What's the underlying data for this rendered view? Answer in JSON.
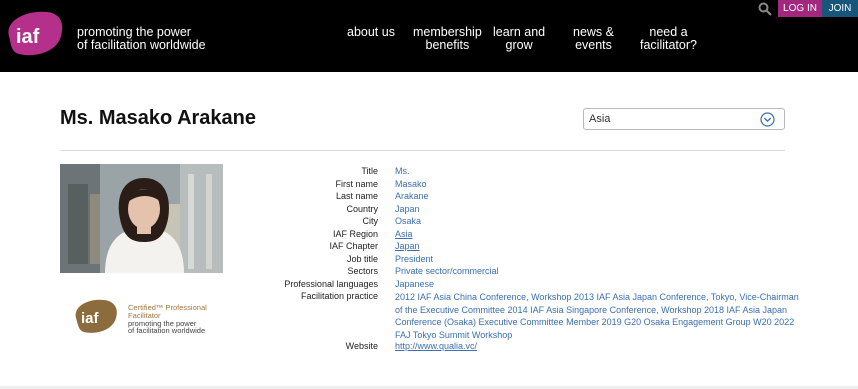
{
  "header": {
    "logo_text": "iaf",
    "tagline_line1": "promoting the power",
    "tagline_line2": "of facilitation worldwide",
    "nav": [
      {
        "line1": "about us",
        "line2": ""
      },
      {
        "line1": "membership",
        "line2": "benefits"
      },
      {
        "line1": "learn and",
        "line2": "grow"
      },
      {
        "line1": "news &",
        "line2": "events"
      },
      {
        "line1": "need a",
        "line2": "facilitator?"
      }
    ],
    "login_label": "LOG IN",
    "join_label": "JOIN",
    "search_icon": "search-icon"
  },
  "profile": {
    "name": "Ms. Masako Arakane",
    "region_select": "Asia",
    "fields": [
      {
        "label": "Title",
        "value": "Ms.",
        "link": false
      },
      {
        "label": "First name",
        "value": "Masako",
        "link": false
      },
      {
        "label": "Last name",
        "value": "Arakane",
        "link": false
      },
      {
        "label": "Country",
        "value": "Japan",
        "link": false
      },
      {
        "label": "City",
        "value": "Osaka",
        "link": false
      },
      {
        "label": "IAF Region",
        "value": "Asia",
        "link": true
      },
      {
        "label": "IAF Chapter",
        "value": "Japan",
        "link": true
      },
      {
        "label": "Job title",
        "value": "President",
        "link": false
      },
      {
        "label": "Sectors",
        "value": "Private sector/commercial",
        "link": false
      },
      {
        "label": "Professional languages",
        "value": "Japanese",
        "link": false
      }
    ],
    "practice_label": "Facilitation practice",
    "practice_lines": [
      "2012 IAF Asia China Conference, Workshop 2013 IAF Asia Japan Conference, Tokyo, Vice-Chairman",
      "of the Executive Committee 2014 IAF Asia Singapore Conference, Workshop 2018 IAF Asia Japan",
      "Conference (Osaka) Executive Committee Member 2019 G20 Osaka Engagement Group W20 2022",
      "FAJ Tokyo Summit Workshop"
    ],
    "website_label": "Website",
    "website": "http://www.qualia.vc/"
  },
  "certification": {
    "logo_text": "iaf",
    "line1": "Certified™ Professional",
    "line2": "Facilitator",
    "line3": "promoting the power",
    "line4": "of facilitation worldwide"
  },
  "colors": {
    "header_bg": "#000000",
    "login_bg": "#a2287e",
    "join_bg": "#17557a",
    "link": "#3a6fb0",
    "logo_purple": "#b4308a",
    "cert_gold": "#a3743c"
  }
}
